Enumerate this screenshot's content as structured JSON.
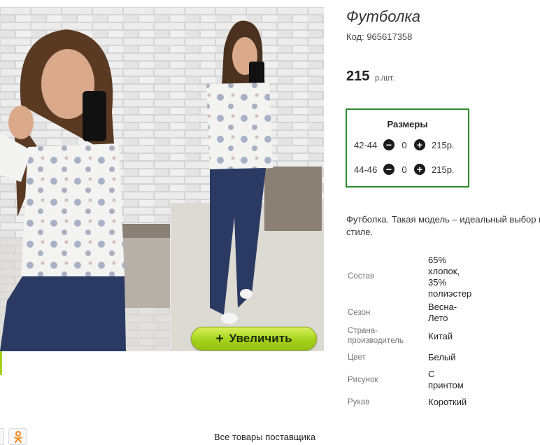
{
  "product": {
    "title": "Футболка",
    "code": "Код: 965617358",
    "price": "215",
    "price_unit": "р./шт."
  },
  "zoom_button": {
    "plus": "+",
    "label": "Увеличить"
  },
  "sizes": {
    "title": "Размеры",
    "rows": [
      {
        "label": "42-44",
        "qty": "0",
        "price": "215р."
      },
      {
        "label": "44-46",
        "qty": "0",
        "price": "215р."
      }
    ]
  },
  "description": "Футболка. Такая модель – идеальный выбор в повседневном стиле.",
  "description_line2": "стиле.",
  "properties": [
    {
      "name": "Состав",
      "value": "65% хлопок, 35% полиэстер"
    },
    {
      "name": "Сезон",
      "value": "Весна-Лето"
    },
    {
      "name": "Страна-производитель",
      "value": "Китай"
    },
    {
      "name": "Цвет",
      "value": "Белый"
    },
    {
      "name": "Рисунок",
      "value": "С принтом"
    },
    {
      "name": "Рукав",
      "value": "Короткий"
    }
  ],
  "footer": {
    "all_products_link": "Все товары поставщика"
  },
  "colors": {
    "accent_green": "#a6d21c",
    "sizes_border": "#2b8a2b"
  }
}
